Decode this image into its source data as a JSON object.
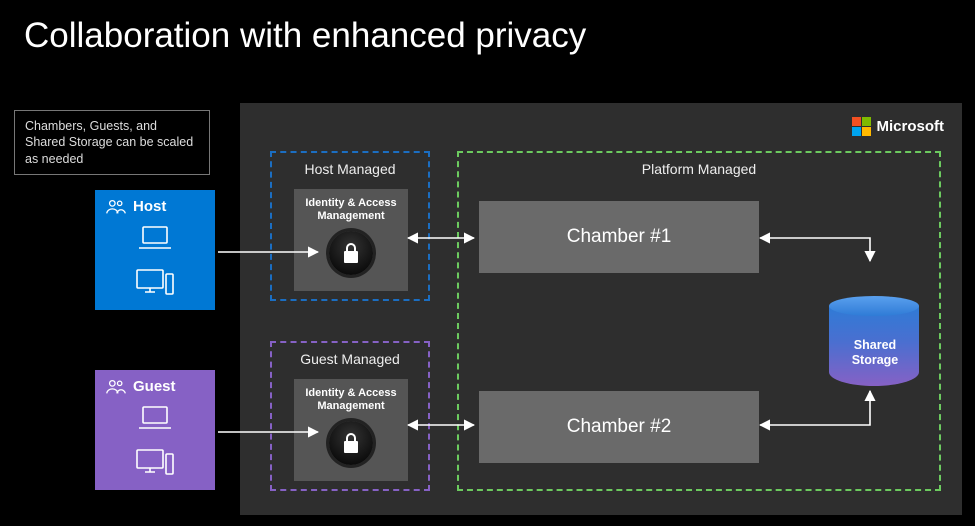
{
  "title": "Collaboration with enhanced privacy",
  "note": "Chambers, Guests, and Shared Storage can be scaled as needed",
  "brand": "Microsoft",
  "parties": {
    "host": "Host",
    "guest": "Guest"
  },
  "managed": {
    "host": "Host Managed",
    "guest": "Guest Managed",
    "iam": "Identity & Access Management"
  },
  "platform": {
    "label": "Platform Managed",
    "chamber1": "Chamber #1",
    "chamber2": "Chamber #2",
    "storage": "Shared Storage"
  },
  "colors": {
    "host": "#0078D4",
    "guest": "#8661C5",
    "platform_border": "#6ccb5f"
  }
}
